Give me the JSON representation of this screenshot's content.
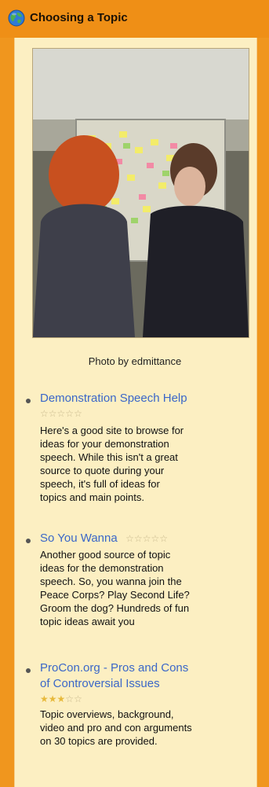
{
  "module": {
    "title": "Choosing a Topic",
    "photo_caption": "Photo by edmittance"
  },
  "links": [
    {
      "title": "Demonstration Speech Help",
      "rating": 0,
      "rating_max": 5,
      "desc_lines": [
        "Here's a good site to browse for",
        "ideas for your demonstration",
        "speech. While this isn't a great",
        "source to quote during your",
        "speech, it's full of ideas for",
        "topics and main points."
      ]
    },
    {
      "title": "So You Wanna",
      "rating": 0,
      "rating_max": 5,
      "desc_lines": [
        "Another good source of topic",
        "ideas for the demonstration",
        "speech. So, you wanna join the",
        "Peace Corps? Play Second Life?",
        "Groom the dog? Hundreds of fun",
        "topic ideas await you"
      ]
    },
    {
      "title": "ProCon.org - Pros and Cons of Controversial Issues",
      "title_lines": [
        "ProCon.org - Pros and Cons",
        "of Controversial Issues"
      ],
      "rating": 3,
      "rating_max": 5,
      "desc_lines": [
        "Topic overviews, background,",
        "video and pro and con arguments",
        "on 30 topics are provided."
      ]
    }
  ]
}
